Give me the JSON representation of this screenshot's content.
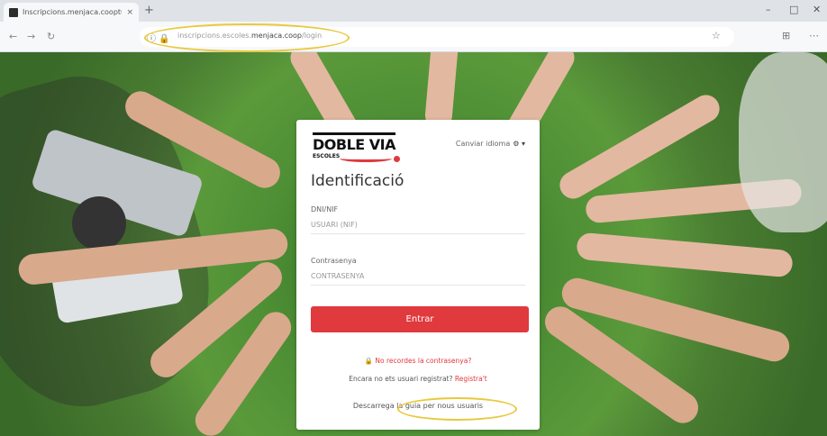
{
  "browser": {
    "tab_title": "Inscripcions.menjaca.cooptu.o",
    "tab_close": "×",
    "new_tab": "+",
    "url_prefix": "inscripcions.escoles.",
    "url_domain": "menjaca.coop",
    "url_path": "/login",
    "controls": {
      "minimize": "–",
      "maximize": "□",
      "close": "✕",
      "back": "←",
      "forward": "→",
      "reload": "↻",
      "star": "☆",
      "extensions": "⊞",
      "more": "⋯"
    }
  },
  "login": {
    "logo_main": "DOBLE VIA",
    "logo_sub": "ESCOLES",
    "language_label": "Canviar idioma",
    "language_icon": "⚙ ▾",
    "title": "Identificació",
    "user_label": "DNI/NIF",
    "user_placeholder": "USUARI (NIF)",
    "password_label": "Contrasenya",
    "password_placeholder": "CONTRASENYA",
    "submit_label": "Entrar",
    "forgot_label": "No recordes la contrasenya?",
    "forgot_icon": "lock-icon",
    "register_prompt": "Encara no ets usuari registrat?",
    "register_link": "Registra't",
    "guide_prompt": "Descarrega la",
    "guide_link": "guia per nous usuaris"
  },
  "colors": {
    "accent": "#e0393e",
    "highlight": "#e8c93c"
  }
}
